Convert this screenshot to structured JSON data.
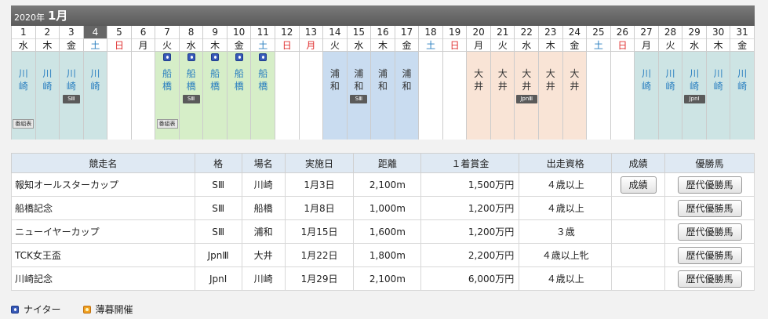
{
  "header": {
    "year": "2020年",
    "month": "1月"
  },
  "calendar": {
    "days": [
      {
        "d": "1",
        "w": "水",
        "type": "weekday",
        "venue": "kawasaki",
        "name": "川崎",
        "grade": "",
        "night": false,
        "program": true
      },
      {
        "d": "2",
        "w": "木",
        "type": "weekday",
        "venue": "kawasaki",
        "name": "川崎",
        "grade": "",
        "night": false,
        "program": false
      },
      {
        "d": "3",
        "w": "金",
        "type": "weekday",
        "venue": "kawasaki",
        "name": "川崎",
        "grade": "SⅢ",
        "night": false,
        "program": false
      },
      {
        "d": "4",
        "w": "土",
        "type": "sat",
        "venue": "kawasaki",
        "name": "川崎",
        "grade": "",
        "night": false,
        "program": false,
        "today": true
      },
      {
        "d": "5",
        "w": "日",
        "type": "sun",
        "venue": "",
        "name": "",
        "grade": "",
        "night": false,
        "program": false
      },
      {
        "d": "6",
        "w": "月",
        "type": "weekday",
        "venue": "",
        "name": "",
        "grade": "",
        "night": false,
        "program": false
      },
      {
        "d": "7",
        "w": "火",
        "type": "weekday",
        "venue": "funabashi",
        "name": "船橋",
        "grade": "",
        "night": true,
        "program": true
      },
      {
        "d": "8",
        "w": "水",
        "type": "weekday",
        "venue": "funabashi",
        "name": "船橋",
        "grade": "SⅢ",
        "night": true,
        "program": false
      },
      {
        "d": "9",
        "w": "木",
        "type": "weekday",
        "venue": "funabashi",
        "name": "船橋",
        "grade": "",
        "night": true,
        "program": false
      },
      {
        "d": "10",
        "w": "金",
        "type": "weekday",
        "venue": "funabashi",
        "name": "船橋",
        "grade": "",
        "night": true,
        "program": false
      },
      {
        "d": "11",
        "w": "土",
        "type": "sat",
        "venue": "funabashi",
        "name": "船橋",
        "grade": "",
        "night": true,
        "program": false
      },
      {
        "d": "12",
        "w": "日",
        "type": "sun",
        "venue": "",
        "name": "",
        "grade": "",
        "night": false,
        "program": false
      },
      {
        "d": "13",
        "w": "月",
        "type": "sun",
        "venue": "",
        "name": "",
        "grade": "",
        "night": false,
        "program": false
      },
      {
        "d": "14",
        "w": "火",
        "type": "weekday",
        "venue": "urawa",
        "name": "浦和",
        "grade": "",
        "night": false,
        "program": false
      },
      {
        "d": "15",
        "w": "水",
        "type": "weekday",
        "venue": "urawa",
        "name": "浦和",
        "grade": "SⅢ",
        "night": false,
        "program": false
      },
      {
        "d": "16",
        "w": "木",
        "type": "weekday",
        "venue": "urawa",
        "name": "浦和",
        "grade": "",
        "night": false,
        "program": false
      },
      {
        "d": "17",
        "w": "金",
        "type": "weekday",
        "venue": "urawa",
        "name": "浦和",
        "grade": "",
        "night": false,
        "program": false
      },
      {
        "d": "18",
        "w": "土",
        "type": "sat",
        "venue": "",
        "name": "",
        "grade": "",
        "night": false,
        "program": false
      },
      {
        "d": "19",
        "w": "日",
        "type": "sun",
        "venue": "",
        "name": "",
        "grade": "",
        "night": false,
        "program": false
      },
      {
        "d": "20",
        "w": "月",
        "type": "weekday",
        "venue": "oi",
        "name": "大井",
        "grade": "",
        "night": false,
        "program": false
      },
      {
        "d": "21",
        "w": "火",
        "type": "weekday",
        "venue": "oi",
        "name": "大井",
        "grade": "",
        "night": false,
        "program": false
      },
      {
        "d": "22",
        "w": "水",
        "type": "weekday",
        "venue": "oi",
        "name": "大井",
        "grade": "JpnⅢ",
        "night": false,
        "program": false
      },
      {
        "d": "23",
        "w": "木",
        "type": "weekday",
        "venue": "oi",
        "name": "大井",
        "grade": "",
        "night": false,
        "program": false
      },
      {
        "d": "24",
        "w": "金",
        "type": "weekday",
        "venue": "oi",
        "name": "大井",
        "grade": "",
        "night": false,
        "program": false
      },
      {
        "d": "25",
        "w": "土",
        "type": "sat",
        "venue": "",
        "name": "",
        "grade": "",
        "night": false,
        "program": false
      },
      {
        "d": "26",
        "w": "日",
        "type": "sun",
        "venue": "",
        "name": "",
        "grade": "",
        "night": false,
        "program": false
      },
      {
        "d": "27",
        "w": "月",
        "type": "weekday",
        "venue": "kawasaki",
        "name": "川崎",
        "grade": "",
        "night": false,
        "program": false
      },
      {
        "d": "28",
        "w": "火",
        "type": "weekday",
        "venue": "kawasaki",
        "name": "川崎",
        "grade": "",
        "night": false,
        "program": false
      },
      {
        "d": "29",
        "w": "水",
        "type": "weekday",
        "venue": "kawasaki",
        "name": "川崎",
        "grade": "JpnⅠ",
        "night": false,
        "program": false
      },
      {
        "d": "30",
        "w": "木",
        "type": "weekday",
        "venue": "kawasaki",
        "name": "川崎",
        "grade": "",
        "night": false,
        "program": false
      },
      {
        "d": "31",
        "w": "金",
        "type": "weekday",
        "venue": "kawasaki",
        "name": "川崎",
        "grade": "",
        "night": false,
        "program": false
      }
    ],
    "program_label": "番組表"
  },
  "table": {
    "headers": [
      "競走名",
      "格",
      "場名",
      "実施日",
      "距離",
      "１着賞金",
      "出走資格",
      "成績",
      "優勝馬"
    ],
    "rows": [
      {
        "name": "報知オールスターカップ",
        "grade": "SⅢ",
        "venue": "川崎",
        "date": "1月3日",
        "distance": "2,100m",
        "prize": "1,500万円",
        "eligibility": "４歳以上",
        "result": "成績",
        "winners": "歴代優勝馬"
      },
      {
        "name": "船橋記念",
        "grade": "SⅢ",
        "venue": "船橋",
        "date": "1月8日",
        "distance": "1,000m",
        "prize": "1,200万円",
        "eligibility": "４歳以上",
        "result": "",
        "winners": "歴代優勝馬"
      },
      {
        "name": "ニューイヤーカップ",
        "grade": "SⅢ",
        "venue": "浦和",
        "date": "1月15日",
        "distance": "1,600m",
        "prize": "1,200万円",
        "eligibility": "３歳",
        "result": "",
        "winners": "歴代優勝馬"
      },
      {
        "name": "TCK女王盃",
        "grade": "JpnⅢ",
        "venue": "大井",
        "date": "1月22日",
        "distance": "1,800m",
        "prize": "2,200万円",
        "eligibility": "４歳以上牝",
        "result": "",
        "winners": "歴代優勝馬"
      },
      {
        "name": "川崎記念",
        "grade": "JpnⅠ",
        "venue": "川崎",
        "date": "1月29日",
        "distance": "2,100m",
        "prize": "6,000万円",
        "eligibility": "４歳以上",
        "result": "",
        "winners": "歴代優勝馬"
      }
    ]
  },
  "legend": {
    "night": "ナイター",
    "dusk": "薄暮開催"
  },
  "colors": {
    "kawasaki": "#cde4e4",
    "funabashi": "#d6eec8",
    "urawa": "#c9dcf0",
    "oi": "#f9e4d6",
    "sun": "#e03030",
    "sat": "#2a7fc0"
  }
}
